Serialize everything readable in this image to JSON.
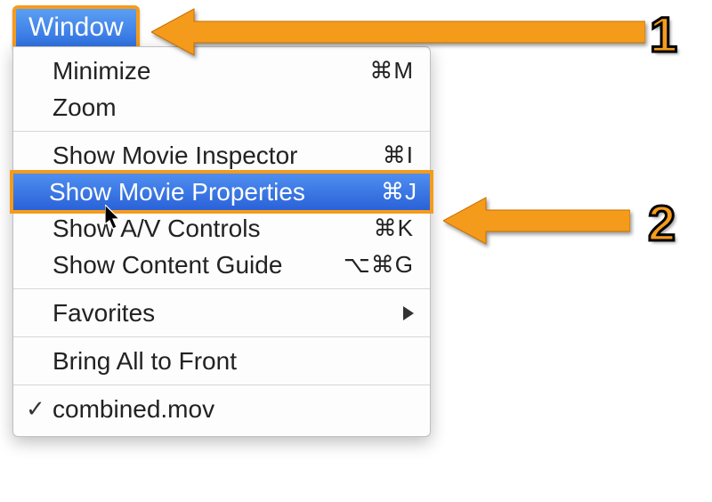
{
  "menubar": {
    "title": "Window"
  },
  "menu": {
    "group1": [
      {
        "label": "Minimize",
        "shortcut": "⌘M"
      },
      {
        "label": "Zoom",
        "shortcut": ""
      }
    ],
    "group2": [
      {
        "label": "Show Movie Inspector",
        "shortcut": "⌘I"
      },
      {
        "label": "Show Movie Properties",
        "shortcut": "⌘J",
        "highlighted": true
      },
      {
        "label": "Show A/V Controls",
        "shortcut": "⌘K"
      },
      {
        "label": "Show Content Guide",
        "shortcut": "⌥⌘G"
      }
    ],
    "group3": [
      {
        "label": "Favorites",
        "submenu": true
      }
    ],
    "group4": [
      {
        "label": "Bring All to Front"
      }
    ],
    "group5": [
      {
        "label": "combined.mov",
        "checked": true
      }
    ]
  },
  "annotations": {
    "step1": "1",
    "step2": "2"
  }
}
